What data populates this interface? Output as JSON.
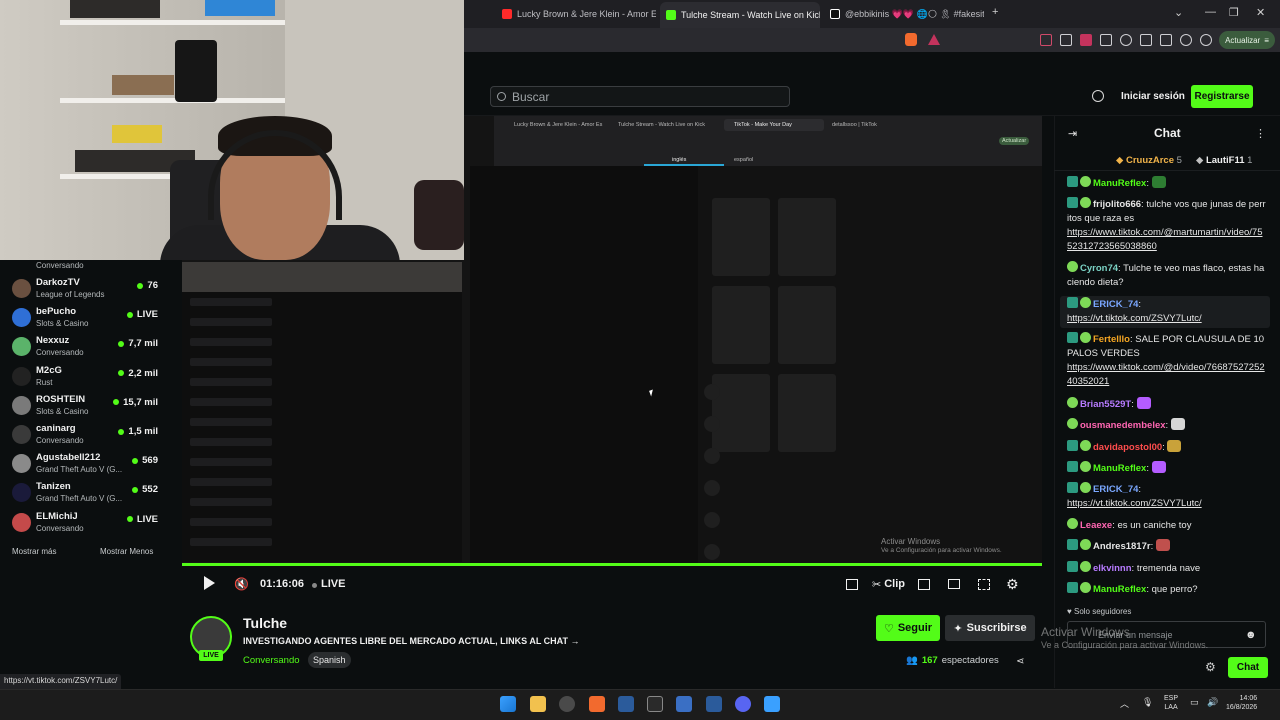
{
  "browser": {
    "tabs": [
      {
        "label": "Lucky Brown & Jere Klein - Amor Esc",
        "icon_color": "#ff2a2a"
      },
      {
        "label": "Tulche Stream - Watch Live on Kick",
        "icon_color": "#53fc18",
        "active": true
      },
      {
        "label": "@ebbikinis 💗💗 🌐🌕 🎗 #fakesitu",
        "icon_color": "#ffffff"
      }
    ],
    "partial_tab": "os",
    "new_tab": "+",
    "update_label": "Actualizar"
  },
  "header": {
    "search_placeholder": "Buscar",
    "login_label": "Iniciar sesión",
    "register_label": "Registrarse"
  },
  "sidebar": {
    "top_partial_category": "Conversando",
    "channels": [
      {
        "name": "DarkozTV",
        "category": "League of Legends",
        "viewers": "76",
        "avatar": "#6a5040"
      },
      {
        "name": "bePucho",
        "category": "Slots & Casino",
        "viewers": "LIVE",
        "avatar": "#2f6fd6"
      },
      {
        "name": "Nexxuz",
        "category": "Conversando",
        "viewers": "7,7 mil",
        "avatar": "#5bb36a"
      },
      {
        "name": "M2cG",
        "category": "Rust",
        "viewers": "2,2 mil",
        "avatar": "#222222"
      },
      {
        "name": "ROSHTEIN",
        "category": "Slots & Casino",
        "viewers": "15,7 mil",
        "avatar": "#7a7a7a"
      },
      {
        "name": "caninarg",
        "category": "Conversando",
        "viewers": "1,5 mil",
        "avatar": "#3a3a3a"
      },
      {
        "name": "Agustabell212",
        "category": "Grand Theft Auto V (G...",
        "viewers": "569",
        "avatar": "#8a8a8a"
      },
      {
        "name": "Tanizen",
        "category": "Grand Theft Auto V (G...",
        "viewers": "552",
        "avatar": "#1a1a3a"
      },
      {
        "name": "ELMichiJ",
        "category": "Conversando",
        "viewers": "LIVE",
        "avatar": "#c44a4a"
      }
    ],
    "show_more": "Mostrar más",
    "show_less": "Mostrar Menos"
  },
  "inner_screen": {
    "tabs": [
      "Lucky Brown & Jere Klein - Amor Es",
      "Tulche Stream - Watch Live on Kick",
      "TikTok - Make Your Day",
      "detallssoo | TikTok"
    ],
    "lang_tabs": [
      "inglés",
      "español"
    ],
    "update_label": "Actualizar",
    "activate_title": "Activar Windows",
    "activate_sub": "Ve a Configuración para activar Windows."
  },
  "player": {
    "time": "01:16:06",
    "live_label": "LIVE",
    "clip_label": "Clip"
  },
  "stream": {
    "streamer": "Tulche",
    "live_badge": "LIVE",
    "title": "INVESTIGANDO AGENTES LIBRE DEL MERCADO ACTUAL, LINKS AL CHAT →",
    "category": "Conversando",
    "language": "Spanish",
    "follow_label": "Seguir",
    "subscribe_label": "Suscribirse",
    "viewers_count": "167",
    "viewers_label": "espectadores"
  },
  "chat": {
    "title": "Chat",
    "pinned": [
      {
        "name": "CruuzArce",
        "count": "5"
      },
      {
        "name": "LautiF11",
        "count": "1"
      }
    ],
    "messages": [
      {
        "user": "ManuReflex",
        "color": "#53fc18",
        "badge": "42",
        "text": ""
      },
      {
        "user": "frijolito666",
        "color": "#e6e6e6",
        "badge": "39",
        "text": "tulche vos que junas de perritos que raza es",
        "link": "https://www.tiktok.com/@martumartin/video/7552312723565038860"
      },
      {
        "user": "Cyron74",
        "color": "#7bd3c5",
        "badge": "",
        "text": "Tulche te veo mas flaco, estas haciendo dieta?"
      },
      {
        "user": "ERICK_74",
        "color": "#7aa7ff",
        "badge": "32",
        "text": "",
        "link": "https://vt.tiktok.com/ZSVY7Lutc/"
      },
      {
        "user": "Fertelllo",
        "color": "#f5a623",
        "badge": "35",
        "text": "SALE POR CLAUSULA DE 10 PALOS VERDES",
        "link": "https://www.tiktok.com/@d/video/7668752725240352021"
      },
      {
        "user": "Brian5529T",
        "color": "#b77bff",
        "badge": "",
        "text": ""
      },
      {
        "user": "ousmanedembelex",
        "color": "#ff66b2",
        "badge": "",
        "text": ""
      },
      {
        "user": "davidapostol00",
        "color": "#ff4d4d",
        "badge": "30",
        "text": ""
      },
      {
        "user": "ManuReflex",
        "color": "#53fc18",
        "badge": "42",
        "text": ""
      },
      {
        "user": "ERICK_74",
        "color": "#7aa7ff",
        "badge": "32",
        "text": "",
        "link": "https://vt.tiktok.com/ZSVY7Lutc/"
      },
      {
        "user": "Leaexe",
        "color": "#ff66b2",
        "badge": "",
        "text": "es un caniche toy"
      },
      {
        "user": "Andres1817r",
        "color": "#e6e6e6",
        "badge": "35",
        "text": ""
      },
      {
        "user": "elkvinnn",
        "color": "#b77bff",
        "badge": "30",
        "text": "tremenda nave"
      },
      {
        "user": "ManuReflex",
        "color": "#53fc18",
        "badge": "42",
        "text": "que perro?"
      }
    ],
    "followers_only": "Solo seguidores",
    "input_placeholder": "Enviar un mensaje",
    "send_label": "Chat",
    "overlay_title": "Activar Windows",
    "overlay_sub": "Ve a Configuración para activar Windows."
  },
  "status_url": "https://vt.tiktok.com/ZSVY7Lutc/",
  "taskbar": {
    "lang_top": "ESP",
    "lang_bottom": "LAA",
    "time": "14:06",
    "date": "16/8/2026"
  },
  "colors": {
    "kick_green": "#53fc18",
    "bg": "#0b0e0f"
  }
}
